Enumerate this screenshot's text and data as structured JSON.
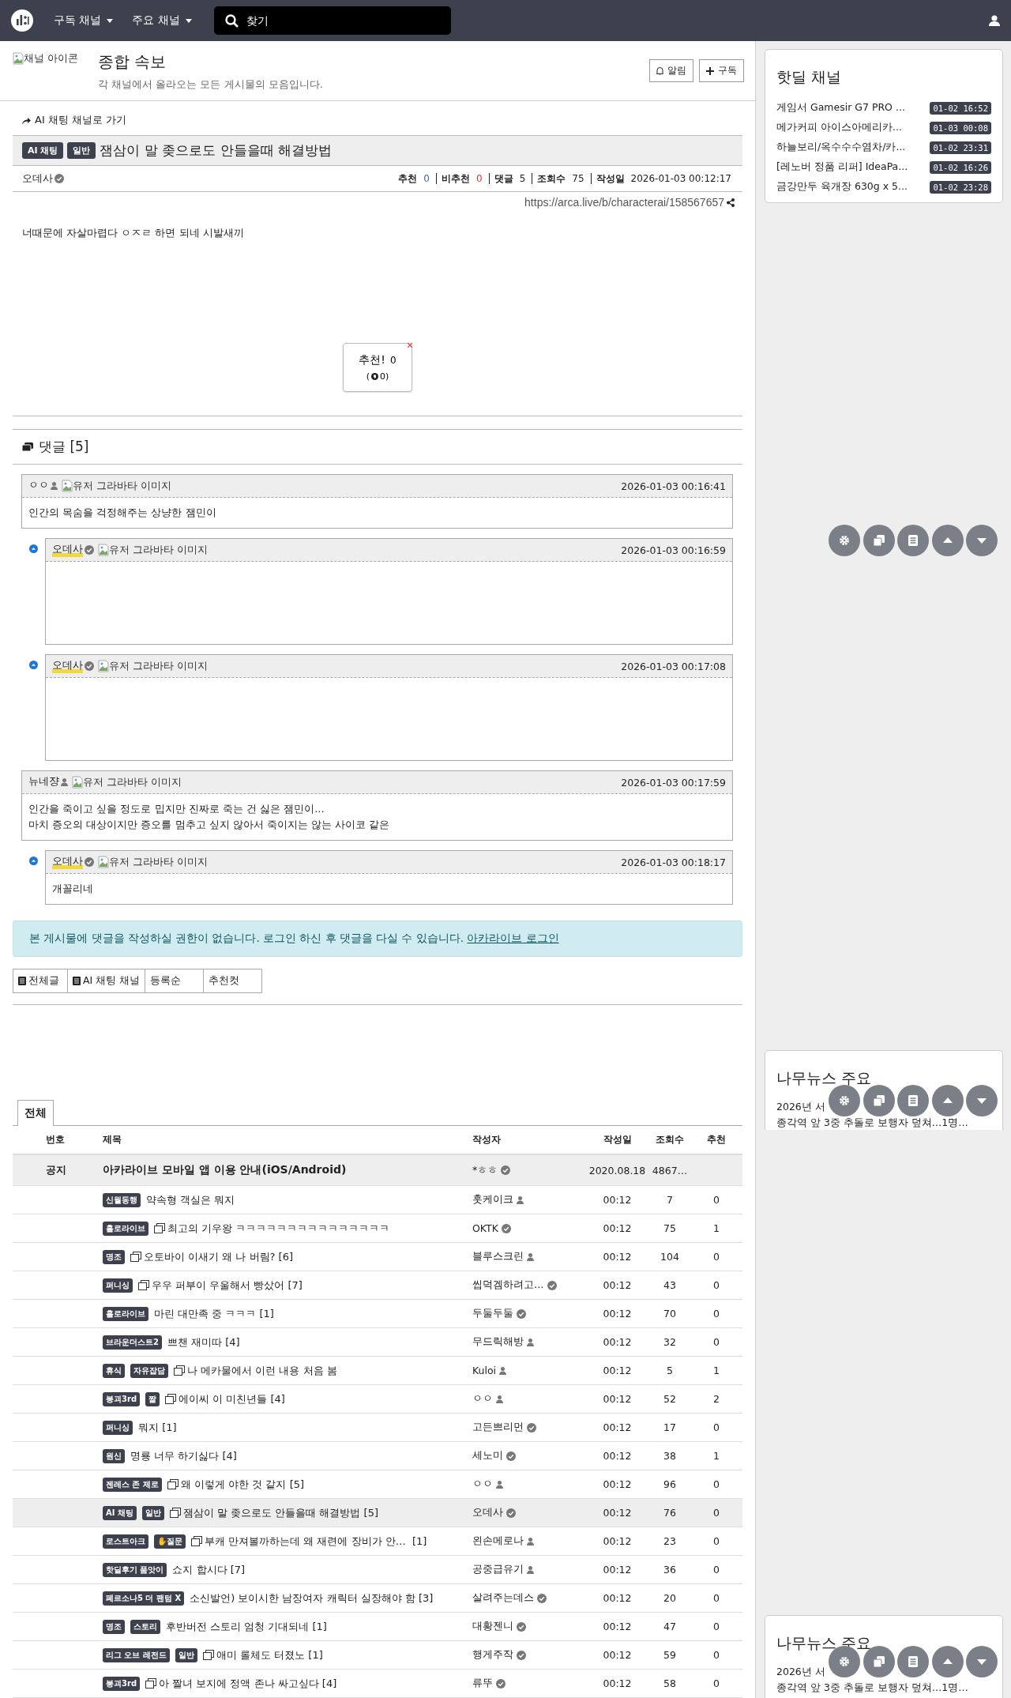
{
  "header": {
    "menus": [
      {
        "label": "구독 채널"
      },
      {
        "label": "주요 채널"
      }
    ],
    "search": {
      "placeholder": "찾기"
    }
  },
  "channel": {
    "icon_alt": "채널 아이콘",
    "title": "종합 속보",
    "description": "각 채널에서 올라오는 모든 게시물의 모음입니다.",
    "buttons": [
      {
        "label": "알림",
        "kind": "bell"
      },
      {
        "label": "구독",
        "kind": "plus"
      }
    ]
  },
  "post": {
    "back_link": "AI 채팅 채널로 가기",
    "badges": [
      "AI 채팅",
      "일반"
    ],
    "title": "잼삼이 말 좆으로도 안들을때 해결방법",
    "author": "오데사",
    "verified": true,
    "stats": [
      {
        "label": "추천",
        "value": "0",
        "color": "#3064d8"
      },
      {
        "label": "비추천",
        "value": "0",
        "color": "#dd3333"
      },
      {
        "label": "댓글",
        "value": "5",
        "color": "#222222"
      },
      {
        "label": "조회수",
        "value": "75",
        "color": "#222222"
      },
      {
        "label": "작성일",
        "value": "2026-01-03 00:12:17",
        "color": "#222222"
      }
    ],
    "url": "https://arca.live/b/characterai/158567657",
    "body": "너때문에 자살마렵다 ㅇㅈㄹ 하면 되네 시발새끼",
    "vote": {
      "label": "추천!",
      "count": "0",
      "down_open": "(",
      "down": "0)"
    }
  },
  "comments": {
    "title": "댓글 [5]",
    "items": [
      {
        "kind": "comment",
        "author": "ㅇㅇ",
        "verified": false,
        "is_op": false,
        "avatar_alt": "유저 그라바타 이미지",
        "time": "2026-01-03 00:16:41",
        "body": [
          "인간의 목숨을 걱정해주는 상냥한 잼민이"
        ]
      },
      {
        "kind": "reply",
        "author": "오데사",
        "verified": true,
        "is_op": true,
        "avatar_alt": "유저 그라바타 이미지",
        "time": "2026-01-03 00:16:59"
      },
      {
        "kind": "reply",
        "author": "오데사",
        "verified": true,
        "is_op": true,
        "avatar_alt": "유저 그라바타 이미지",
        "time": "2026-01-03 00:17:08"
      },
      {
        "kind": "comment",
        "author": "뉴네쟝",
        "verified": false,
        "is_op": false,
        "avatar_alt": "유저 그라바타 이미지",
        "time": "2026-01-03 00:17:59",
        "body": [
          "인간을 죽이고 싶을 정도로 밉지만 진짜로 죽는 건 싫은 잼민이...",
          "마치 증오의 대상이지만 증오를 멈추고 싶지 않아서 죽이지는 않는 사이코 같은"
        ]
      },
      {
        "kind": "reply",
        "author": "오데사",
        "verified": true,
        "is_op": true,
        "avatar_alt": "유저 그라바타 이미지",
        "time": "2026-01-03 00:18:17",
        "body": [
          "개꼴리네"
        ]
      }
    ]
  },
  "notice": {
    "text": "본 게시물에 댓글을 작성하실 권한이 없습니다. 로그인 하신 후 댓글을 다실 수 있습니다.",
    "link": "아카라이브 로그인"
  },
  "filter_tabs": [
    {
      "label": "전체글",
      "kind": "icon"
    },
    {
      "label": "AI 채팅 채널",
      "kind": "icon"
    },
    {
      "label": "등록순",
      "kind": "plain"
    },
    {
      "label": "추천컷",
      "kind": "plain"
    }
  ],
  "board": {
    "tabs": [
      {
        "label": "전체",
        "selected": true
      }
    ],
    "columns": [
      "번호",
      "제목",
      "작성자",
      "작성일",
      "조회수",
      "추천"
    ],
    "rows": [
      {
        "kind": "notice",
        "selected": false,
        "number": "공지",
        "title": "아카라이브 모바일 앱 이용 안내(iOS/Android)",
        "author": "*ㅎㅎ",
        "verified": true,
        "date": "2020.08.18",
        "views": "4867…"
      },
      {
        "kind": "post",
        "selected": false,
        "badges": [
          "신월동행"
        ],
        "title": "약속형 객실은 뭐지",
        "author": "훗케이크",
        "verified": false,
        "date": "00:12",
        "views": "7",
        "votes": "0"
      },
      {
        "kind": "post",
        "selected": false,
        "badges": [
          "홀로라이브"
        ],
        "image": true,
        "title": "최고의 기우왕 ㅋㅋㅋㅋㅋㅋㅋㅋㅋㅋㅋㅋㅋㅋㅋ",
        "author": "OKTK",
        "verified": true,
        "date": "00:12",
        "views": "75",
        "votes": "1"
      },
      {
        "kind": "post",
        "selected": false,
        "badges": [
          "명조"
        ],
        "image": true,
        "title": "오토바이 이새기 왜 나 버림? [6]",
        "author": "블루스크린",
        "verified": false,
        "date": "00:12",
        "views": "104",
        "votes": "0"
      },
      {
        "kind": "post",
        "selected": false,
        "badges": [
          "퍼니싱"
        ],
        "image": true,
        "title": "우우 퍼부이 우울해서 빵샀어 [7]",
        "author": "씹덕겜하려고…",
        "verified": true,
        "date": "00:12",
        "views": "43",
        "votes": "0"
      },
      {
        "kind": "post",
        "selected": false,
        "badges": [
          "홀로라이브"
        ],
        "title": "마린 대만족 중 ㅋㅋㅋ [1]",
        "author": "두둘두둘",
        "verified": true,
        "date": "00:12",
        "views": "70",
        "votes": "0"
      },
      {
        "kind": "post",
        "selected": false,
        "badges": [
          "브라운더스트2"
        ],
        "title": "쁘챈 재미따 [4]",
        "author": "무드릭해방",
        "verified": false,
        "date": "00:12",
        "views": "32",
        "votes": "0"
      },
      {
        "kind": "post",
        "selected": false,
        "badges": [
          "휴식",
          "자유잡담"
        ],
        "image": true,
        "title": "나 메카물에서 이런 내용 처음 봄",
        "author": "Kuloi",
        "verified": false,
        "date": "00:12",
        "views": "5",
        "votes": "1"
      },
      {
        "kind": "post",
        "selected": false,
        "badges": [
          "붕괴3rd",
          "짤"
        ],
        "image": true,
        "title": "에이씨 이 미친년들 [4]",
        "author": "ㅇㅇ",
        "verified": false,
        "date": "00:12",
        "views": "52",
        "votes": "2"
      },
      {
        "kind": "post",
        "selected": false,
        "badges": [
          "퍼니싱"
        ],
        "title": "뭐지 [1]",
        "author": "고든쁘리먼",
        "verified": true,
        "date": "00:12",
        "views": "17",
        "votes": "0"
      },
      {
        "kind": "post",
        "selected": false,
        "badges": [
          "원신"
        ],
        "title": "명룡 너무 하기싫다 [4]",
        "author": "세노미",
        "verified": true,
        "date": "00:12",
        "views": "38",
        "votes": "1"
      },
      {
        "kind": "post",
        "selected": false,
        "badges": [
          "젠레스 존 제로"
        ],
        "image": true,
        "title": "왜 이렇게 야한 것 같지 [5]",
        "author": "ㅇㅇ",
        "verified": false,
        "date": "00:12",
        "views": "96",
        "votes": "0"
      },
      {
        "kind": "post",
        "selected": true,
        "badges": [
          "AI 채팅",
          "일반"
        ],
        "image": true,
        "title": "잼삼이 말 좆으로도 안들을때 해결방법 [5]",
        "author": "오데사",
        "verified": true,
        "date": "00:12",
        "views": "76",
        "votes": "0"
      },
      {
        "kind": "post",
        "selected": false,
        "badges": [
          "로스트아크",
          "✋질문"
        ],
        "image": true,
        "title": "부캐 만져볼까하는데 왜 재련에 장비가 안…  [1]",
        "author": "왼손메로나",
        "verified": false,
        "date": "00:12",
        "views": "23",
        "votes": "0"
      },
      {
        "kind": "post",
        "selected": false,
        "badges": [
          "핫딜후기 품앗이"
        ],
        "title": "쇼지 합시다 [7]",
        "author": "공중급유기",
        "verified": false,
        "date": "00:12",
        "views": "36",
        "votes": "0"
      },
      {
        "kind": "post",
        "selected": false,
        "badges": [
          "페르소나5 더 팬텀 X"
        ],
        "title": "소신발언) 보이시한 남장여자 캐릭터 실장해야 함 [3]",
        "author": "살려주는데스",
        "verified": true,
        "date": "00:12",
        "views": "20",
        "votes": "0"
      },
      {
        "kind": "post",
        "selected": false,
        "badges": [
          "명조",
          "스토리"
        ],
        "title": "후반버전 스토리 엄청 기대되네 [1]",
        "author": "대황젠니",
        "verified": true,
        "date": "00:12",
        "views": "47",
        "votes": "0"
      },
      {
        "kind": "post",
        "selected": false,
        "badges": [
          "리그 오브 레전드",
          "일반"
        ],
        "image": true,
        "title": "애미 롤체도 터졌노 [1]",
        "author": "행게주작",
        "verified": true,
        "date": "00:12",
        "views": "59",
        "votes": "0"
      },
      {
        "kind": "post",
        "selected": false,
        "badges": [
          "붕괴3rd"
        ],
        "image": true,
        "title": "아 짤녀 보지에 정액 존나 싸고싶다 [4]",
        "author": "류뚜",
        "verified": true,
        "date": "00:12",
        "views": "58",
        "votes": "0"
      }
    ]
  },
  "sidebar": {
    "hot_deals": {
      "title": "핫딜 채널",
      "items": [
        {
          "title": "게임서 Gamesir G7 PRO ...",
          "time": "01-02 16:52"
        },
        {
          "title": "메가커피 아이스아메리카...",
          "time": "01-03 00:08"
        },
        {
          "title": "하늘보리/옥수수수염차/카...",
          "time": "01-02 23:31"
        },
        {
          "title": "[레노버 정품 리퍼] IdeaPa...",
          "time": "01-02 16:26"
        },
        {
          "title": "금강만두 육개장 630g x 5...",
          "time": "01-02 23:28"
        }
      ]
    },
    "news": [
      {
        "title": "나무뉴스 주요",
        "items": [
          "2026년 서",
          "종각역 앞 3중 추돌로 보행자 덮쳐…1명…"
        ]
      },
      {
        "title": "나무뉴스 주요",
        "items": [
          "2026년 서",
          "종각역 앞 3중 추돌로 보행자 덮쳐…1명…"
        ]
      }
    ]
  }
}
